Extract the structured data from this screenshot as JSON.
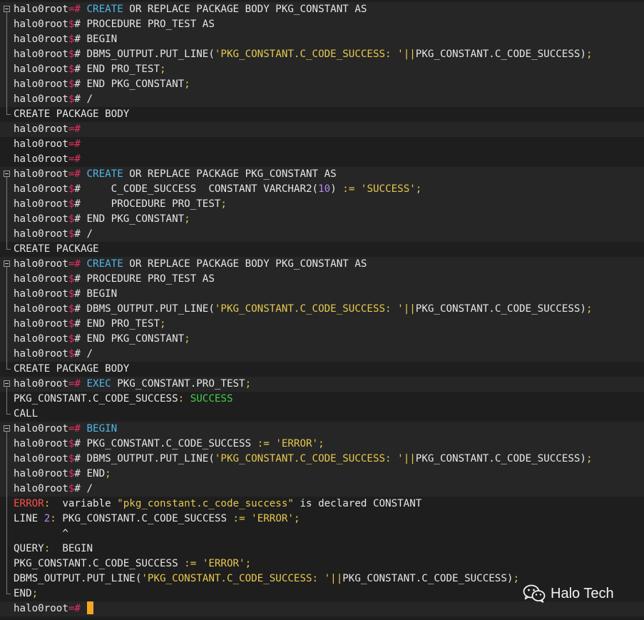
{
  "colors": {
    "background": "#1e1e1e",
    "command_band": "#262626",
    "prompt_sign": "#e0305f",
    "keyword": "#4fb6e8",
    "string": "#e6c84e",
    "number": "#b48af0",
    "error": "#ff4d4d",
    "success": "#3ecf4a",
    "cursor": "#f5a623"
  },
  "watermark": {
    "icon": "wechat-icon",
    "text": "Halo Tech"
  },
  "terminal": {
    "lines": [
      {
        "kind": "cmd",
        "gutter": "start",
        "parts": [
          {
            "t": "halo0root",
            "c": "default"
          },
          {
            "t": "=# ",
            "c": "prompt-sign"
          },
          {
            "t": "CREATE",
            "c": "keyword"
          },
          {
            "t": " OR REPLACE PACKAGE BODY PKG_CONSTANT AS",
            "c": "default"
          }
        ]
      },
      {
        "kind": "cmd",
        "gutter": "mid",
        "parts": [
          {
            "t": "halo0root",
            "c": "default"
          },
          {
            "t": "$",
            "c": "prompt-sign"
          },
          {
            "t": "# PROCEDURE PRO_TEST AS",
            "c": "default"
          }
        ]
      },
      {
        "kind": "cmd",
        "gutter": "mid",
        "parts": [
          {
            "t": "halo0root",
            "c": "default"
          },
          {
            "t": "$",
            "c": "prompt-sign"
          },
          {
            "t": "# BEGIN",
            "c": "default"
          }
        ]
      },
      {
        "kind": "cmd",
        "gutter": "mid",
        "parts": [
          {
            "t": "halo0root",
            "c": "default"
          },
          {
            "t": "$",
            "c": "prompt-sign"
          },
          {
            "t": "# DBMS_OUTPUT.PUT_LINE(",
            "c": "default"
          },
          {
            "t": "'PKG_CONSTANT.C_CODE_SUCCESS: '",
            "c": "string"
          },
          {
            "t": "||",
            "c": "op"
          },
          {
            "t": "PKG_CONSTANT.C_CODE_SUCCESS)",
            "c": "default"
          },
          {
            "t": ";",
            "c": "op"
          }
        ]
      },
      {
        "kind": "cmd",
        "gutter": "mid",
        "parts": [
          {
            "t": "halo0root",
            "c": "default"
          },
          {
            "t": "$",
            "c": "prompt-sign"
          },
          {
            "t": "# END PRO_TEST",
            "c": "default"
          },
          {
            "t": ";",
            "c": "op"
          }
        ]
      },
      {
        "kind": "cmd",
        "gutter": "mid",
        "parts": [
          {
            "t": "halo0root",
            "c": "default"
          },
          {
            "t": "$",
            "c": "prompt-sign"
          },
          {
            "t": "# END PKG_CONSTANT",
            "c": "default"
          },
          {
            "t": ";",
            "c": "op"
          }
        ]
      },
      {
        "kind": "cmd",
        "gutter": "mid",
        "parts": [
          {
            "t": "halo0root",
            "c": "default"
          },
          {
            "t": "$",
            "c": "prompt-sign"
          },
          {
            "t": "# /",
            "c": "default"
          }
        ]
      },
      {
        "kind": "out",
        "gutter": "end",
        "parts": [
          {
            "t": "CREATE PACKAGE BODY",
            "c": "default"
          }
        ]
      },
      {
        "kind": "cmd",
        "gutter": "none",
        "parts": [
          {
            "t": "halo0root",
            "c": "default"
          },
          {
            "t": "=#",
            "c": "prompt-sign"
          }
        ]
      },
      {
        "kind": "out",
        "gutter": "none",
        "parts": [
          {
            "t": "halo0root",
            "c": "default"
          },
          {
            "t": "=#",
            "c": "prompt-sign"
          }
        ]
      },
      {
        "kind": "out",
        "gutter": "none",
        "parts": [
          {
            "t": "halo0root",
            "c": "default"
          },
          {
            "t": "=#",
            "c": "prompt-sign"
          }
        ]
      },
      {
        "kind": "cmd",
        "gutter": "start",
        "parts": [
          {
            "t": "halo0root",
            "c": "default"
          },
          {
            "t": "=# ",
            "c": "prompt-sign"
          },
          {
            "t": "CREATE",
            "c": "keyword"
          },
          {
            "t": " OR REPLACE PACKAGE PKG_CONSTANT AS",
            "c": "default"
          }
        ]
      },
      {
        "kind": "cmd",
        "gutter": "mid",
        "parts": [
          {
            "t": "halo0root",
            "c": "default"
          },
          {
            "t": "$",
            "c": "prompt-sign"
          },
          {
            "t": "#     C_CODE_SUCCESS  CONSTANT VARCHAR2(",
            "c": "default"
          },
          {
            "t": "10",
            "c": "number"
          },
          {
            "t": ") ",
            "c": "default"
          },
          {
            "t": ":=",
            "c": "op"
          },
          {
            "t": " ",
            "c": "default"
          },
          {
            "t": "'SUCCESS'",
            "c": "string"
          },
          {
            "t": ";",
            "c": "op"
          }
        ]
      },
      {
        "kind": "cmd",
        "gutter": "mid",
        "parts": [
          {
            "t": "halo0root",
            "c": "default"
          },
          {
            "t": "$",
            "c": "prompt-sign"
          },
          {
            "t": "#     PROCEDURE PRO_TEST",
            "c": "default"
          },
          {
            "t": ";",
            "c": "op"
          }
        ]
      },
      {
        "kind": "cmd",
        "gutter": "mid",
        "parts": [
          {
            "t": "halo0root",
            "c": "default"
          },
          {
            "t": "$",
            "c": "prompt-sign"
          },
          {
            "t": "# END PKG_CONSTANT",
            "c": "default"
          },
          {
            "t": ";",
            "c": "op"
          }
        ]
      },
      {
        "kind": "cmd",
        "gutter": "mid",
        "parts": [
          {
            "t": "halo0root",
            "c": "default"
          },
          {
            "t": "$",
            "c": "prompt-sign"
          },
          {
            "t": "# /",
            "c": "default"
          }
        ]
      },
      {
        "kind": "out",
        "gutter": "end",
        "parts": [
          {
            "t": "CREATE PACKAGE",
            "c": "default"
          }
        ]
      },
      {
        "kind": "cmd",
        "gutter": "start",
        "parts": [
          {
            "t": "halo0root",
            "c": "default"
          },
          {
            "t": "=# ",
            "c": "prompt-sign"
          },
          {
            "t": "CREATE",
            "c": "keyword"
          },
          {
            "t": " OR REPLACE PACKAGE BODY PKG_CONSTANT AS",
            "c": "default"
          }
        ]
      },
      {
        "kind": "cmd",
        "gutter": "mid",
        "parts": [
          {
            "t": "halo0root",
            "c": "default"
          },
          {
            "t": "$",
            "c": "prompt-sign"
          },
          {
            "t": "# PROCEDURE PRO_TEST AS",
            "c": "default"
          }
        ]
      },
      {
        "kind": "cmd",
        "gutter": "mid",
        "parts": [
          {
            "t": "halo0root",
            "c": "default"
          },
          {
            "t": "$",
            "c": "prompt-sign"
          },
          {
            "t": "# BEGIN",
            "c": "default"
          }
        ]
      },
      {
        "kind": "cmd",
        "gutter": "mid",
        "parts": [
          {
            "t": "halo0root",
            "c": "default"
          },
          {
            "t": "$",
            "c": "prompt-sign"
          },
          {
            "t": "# DBMS_OUTPUT.PUT_LINE(",
            "c": "default"
          },
          {
            "t": "'PKG_CONSTANT.C_CODE_SUCCESS: '",
            "c": "string"
          },
          {
            "t": "||",
            "c": "op"
          },
          {
            "t": "PKG_CONSTANT.C_CODE_SUCCESS)",
            "c": "default"
          },
          {
            "t": ";",
            "c": "op"
          }
        ]
      },
      {
        "kind": "cmd",
        "gutter": "mid",
        "parts": [
          {
            "t": "halo0root",
            "c": "default"
          },
          {
            "t": "$",
            "c": "prompt-sign"
          },
          {
            "t": "# END PRO_TEST",
            "c": "default"
          },
          {
            "t": ";",
            "c": "op"
          }
        ]
      },
      {
        "kind": "cmd",
        "gutter": "mid",
        "parts": [
          {
            "t": "halo0root",
            "c": "default"
          },
          {
            "t": "$",
            "c": "prompt-sign"
          },
          {
            "t": "# END PKG_CONSTANT",
            "c": "default"
          },
          {
            "t": ";",
            "c": "op"
          }
        ]
      },
      {
        "kind": "cmd",
        "gutter": "mid",
        "parts": [
          {
            "t": "halo0root",
            "c": "default"
          },
          {
            "t": "$",
            "c": "prompt-sign"
          },
          {
            "t": "# /",
            "c": "default"
          }
        ]
      },
      {
        "kind": "out",
        "gutter": "end",
        "parts": [
          {
            "t": "CREATE PACKAGE BODY",
            "c": "default"
          }
        ]
      },
      {
        "kind": "cmd",
        "gutter": "start",
        "parts": [
          {
            "t": "halo0root",
            "c": "default"
          },
          {
            "t": "=# ",
            "c": "prompt-sign"
          },
          {
            "t": "EXEC",
            "c": "keyword"
          },
          {
            "t": " PKG_CONSTANT.PRO_TEST",
            "c": "default"
          },
          {
            "t": ";",
            "c": "op"
          }
        ]
      },
      {
        "kind": "out",
        "gutter": "mid",
        "parts": [
          {
            "t": "PKG_CONSTANT.C_CODE_SUCCESS",
            "c": "default"
          },
          {
            "t": ": ",
            "c": "op"
          },
          {
            "t": "SUCCESS",
            "c": "success"
          }
        ]
      },
      {
        "kind": "out",
        "gutter": "end",
        "parts": [
          {
            "t": "CALL",
            "c": "default"
          }
        ]
      },
      {
        "kind": "cmd",
        "gutter": "start",
        "parts": [
          {
            "t": "halo0root",
            "c": "default"
          },
          {
            "t": "=# ",
            "c": "prompt-sign"
          },
          {
            "t": "BEGIN",
            "c": "keyword"
          }
        ]
      },
      {
        "kind": "cmd",
        "gutter": "mid",
        "parts": [
          {
            "t": "halo0root",
            "c": "default"
          },
          {
            "t": "$",
            "c": "prompt-sign"
          },
          {
            "t": "# PKG_CONSTANT.C_CODE_SUCCESS ",
            "c": "default"
          },
          {
            "t": ":=",
            "c": "op"
          },
          {
            "t": " ",
            "c": "default"
          },
          {
            "t": "'ERROR'",
            "c": "string"
          },
          {
            "t": ";",
            "c": "op"
          }
        ]
      },
      {
        "kind": "cmd",
        "gutter": "mid",
        "parts": [
          {
            "t": "halo0root",
            "c": "default"
          },
          {
            "t": "$",
            "c": "prompt-sign"
          },
          {
            "t": "# DBMS_OUTPUT.PUT_LINE(",
            "c": "default"
          },
          {
            "t": "'PKG_CONSTANT.C_CODE_SUCCESS: '",
            "c": "string"
          },
          {
            "t": "||",
            "c": "op"
          },
          {
            "t": "PKG_CONSTANT.C_CODE_SUCCESS)",
            "c": "default"
          },
          {
            "t": ";",
            "c": "op"
          }
        ]
      },
      {
        "kind": "cmd",
        "gutter": "mid",
        "parts": [
          {
            "t": "halo0root",
            "c": "default"
          },
          {
            "t": "$",
            "c": "prompt-sign"
          },
          {
            "t": "# END",
            "c": "default"
          },
          {
            "t": ";",
            "c": "op"
          }
        ]
      },
      {
        "kind": "cmd",
        "gutter": "mid",
        "parts": [
          {
            "t": "halo0root",
            "c": "default"
          },
          {
            "t": "$",
            "c": "prompt-sign"
          },
          {
            "t": "# /",
            "c": "default"
          }
        ]
      },
      {
        "kind": "out",
        "gutter": "mid",
        "parts": [
          {
            "t": "ERROR",
            "c": "error"
          },
          {
            "t": ":  ",
            "c": "op"
          },
          {
            "t": "variable ",
            "c": "default"
          },
          {
            "t": "\"pkg_constant.c_code_success\"",
            "c": "string"
          },
          {
            "t": " is declared CONSTANT",
            "c": "default"
          }
        ]
      },
      {
        "kind": "out",
        "gutter": "mid",
        "parts": [
          {
            "t": "LINE ",
            "c": "default"
          },
          {
            "t": "2",
            "c": "number"
          },
          {
            "t": ": ",
            "c": "op"
          },
          {
            "t": "PKG_CONSTANT.C_CODE_SUCCESS ",
            "c": "default"
          },
          {
            "t": ":=",
            "c": "op"
          },
          {
            "t": " ",
            "c": "default"
          },
          {
            "t": "'ERROR'",
            "c": "string"
          },
          {
            "t": ";",
            "c": "op"
          }
        ]
      },
      {
        "kind": "out",
        "gutter": "mid",
        "parts": [
          {
            "t": "        ^",
            "c": "default"
          }
        ]
      },
      {
        "kind": "out",
        "gutter": "mid",
        "parts": [
          {
            "t": "QUERY",
            "c": "default"
          },
          {
            "t": ":  ",
            "c": "op"
          },
          {
            "t": "BEGIN",
            "c": "default"
          }
        ]
      },
      {
        "kind": "out",
        "gutter": "mid",
        "parts": [
          {
            "t": "PKG_CONSTANT.C_CODE_SUCCESS ",
            "c": "default"
          },
          {
            "t": ":=",
            "c": "op"
          },
          {
            "t": " ",
            "c": "default"
          },
          {
            "t": "'ERROR'",
            "c": "string"
          },
          {
            "t": ";",
            "c": "op"
          }
        ]
      },
      {
        "kind": "out",
        "gutter": "mid",
        "parts": [
          {
            "t": "DBMS_OUTPUT.PUT_LINE(",
            "c": "default"
          },
          {
            "t": "'PKG_CONSTANT.C_CODE_SUCCESS: '",
            "c": "string"
          },
          {
            "t": "||",
            "c": "op"
          },
          {
            "t": "PKG_CONSTANT.C_CODE_SUCCESS)",
            "c": "default"
          },
          {
            "t": ";",
            "c": "op"
          }
        ]
      },
      {
        "kind": "out",
        "gutter": "end",
        "parts": [
          {
            "t": "END",
            "c": "default"
          },
          {
            "t": ";",
            "c": "op"
          }
        ]
      },
      {
        "kind": "cmd",
        "gutter": "none",
        "cursor": true,
        "parts": [
          {
            "t": "halo0root",
            "c": "default"
          },
          {
            "t": "=# ",
            "c": "prompt-sign"
          }
        ]
      }
    ]
  }
}
